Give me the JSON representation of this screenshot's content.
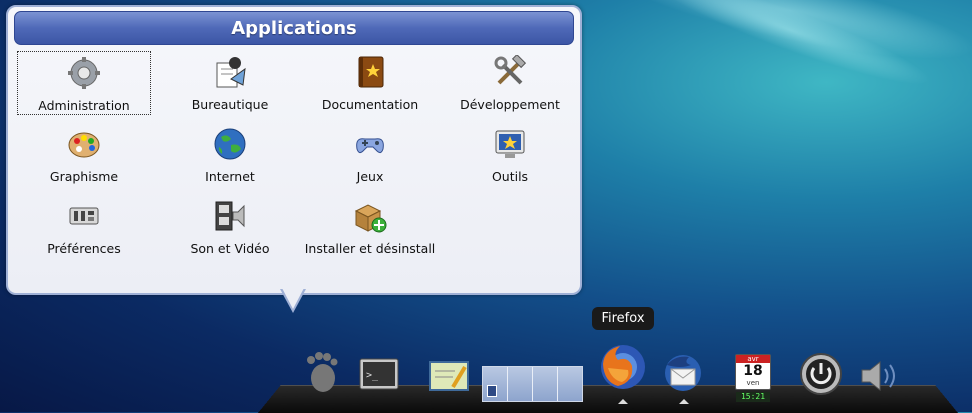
{
  "popup": {
    "title": "Applications",
    "items": [
      {
        "label": "Administration",
        "icon": "gear-icon"
      },
      {
        "label": "Bureautique",
        "icon": "office-icon"
      },
      {
        "label": "Documentation",
        "icon": "book-icon"
      },
      {
        "label": "Développement",
        "icon": "tools-icon"
      },
      {
        "label": "Graphisme",
        "icon": "palette-icon"
      },
      {
        "label": "Internet",
        "icon": "globe-icon"
      },
      {
        "label": "Jeux",
        "icon": "gamepad-icon"
      },
      {
        "label": "Outils",
        "icon": "monitor-star-icon"
      },
      {
        "label": "Préférences",
        "icon": "preferences-icon"
      },
      {
        "label": "Son et Vidéo",
        "icon": "media-icon"
      },
      {
        "label": "Installer et désinstall",
        "icon": "package-add-icon"
      }
    ]
  },
  "tooltip": {
    "text": "Firefox"
  },
  "dock": {
    "calendar": {
      "month": "avr",
      "day": "18",
      "weekday": "ven",
      "time": "15:21"
    }
  }
}
